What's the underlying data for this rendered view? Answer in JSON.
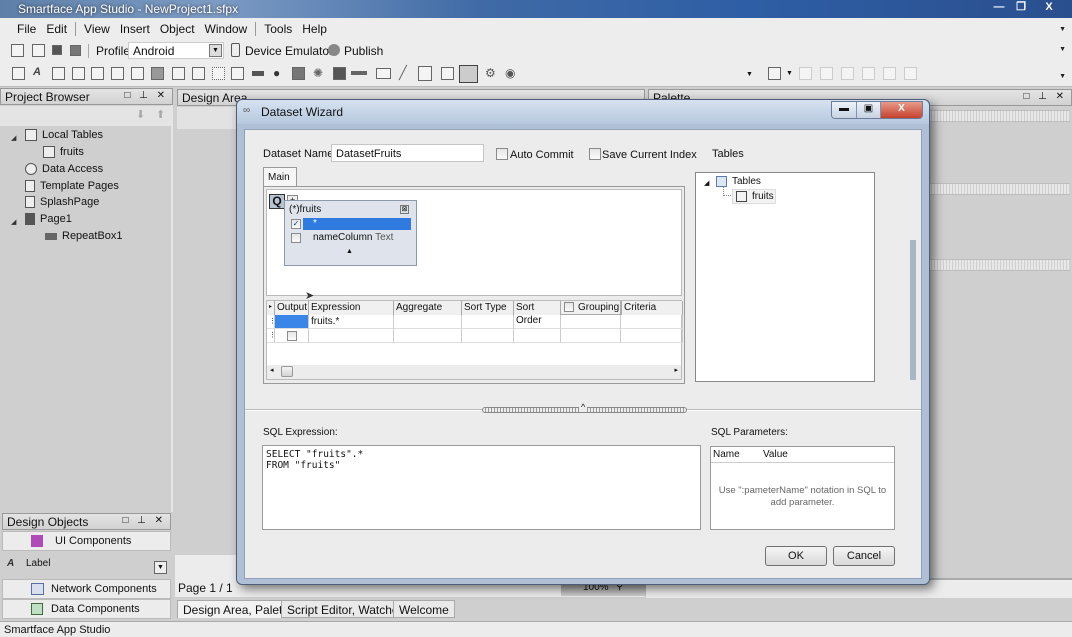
{
  "window": {
    "title": "Smartface App Studio - NewProject1.sfpx",
    "controls": {
      "minimize": "—",
      "restore": "❐",
      "close": "X"
    }
  },
  "menubar": {
    "items": [
      "File",
      "Edit",
      "View",
      "Insert",
      "Object",
      "Window",
      "Tools",
      "Help"
    ]
  },
  "toolbar": {
    "profile_label": "Profile",
    "profile_value": "Android",
    "device_emulator_label": "Device Emulator",
    "publish_label": "Publish"
  },
  "project_browser": {
    "title": "Project Browser",
    "items": [
      {
        "label": "Local Tables",
        "icon": "table-icon",
        "expanded": true
      },
      {
        "label": "fruits",
        "icon": "table-icon"
      },
      {
        "label": "Data Access",
        "icon": "data-access-icon"
      },
      {
        "label": "Template Pages",
        "icon": "template-page-icon"
      },
      {
        "label": "SplashPage",
        "icon": "page-icon"
      },
      {
        "label": "Page1",
        "icon": "page-icon",
        "expanded": true
      },
      {
        "label": "RepeatBox1",
        "icon": "repeatbox-icon"
      }
    ]
  },
  "design_area": {
    "title": "Design Area",
    "page_indicator": "Page  1 / 1",
    "zoom": "100%"
  },
  "palette": {
    "title": "Palette"
  },
  "design_objects": {
    "title": "Design Objects",
    "groups": [
      "UI Components",
      "Network Components",
      "Data Components"
    ],
    "current_item": "Label"
  },
  "bottom_tabs": [
    "Design Area, Palette",
    "Script Editor,  Watches",
    "Welcome"
  ],
  "status_bar": {
    "text": "Smartface App Studio"
  },
  "dialog": {
    "title": "Dataset Wizard",
    "dataset_name_label": "Dataset Name",
    "dataset_name_value": "DatasetFruits",
    "auto_commit_label": "Auto Commit",
    "auto_commit_checked": false,
    "save_current_index_label": "Save Current Index",
    "save_current_index_checked": false,
    "tables_label": "Tables",
    "main_tab": "Main",
    "query_btn": "Q",
    "add_btn": "+",
    "table_box": {
      "title": "(*)fruits",
      "rows": [
        {
          "label": "*",
          "type": "",
          "checked": true,
          "selected": true
        },
        {
          "label": "nameColumn",
          "type": "Text",
          "checked": false,
          "selected": false
        }
      ]
    },
    "grid": {
      "columns": [
        "Output",
        "Expression",
        "Aggregate",
        "Sort Type",
        "Sort Order",
        "Grouping",
        "Criteria"
      ],
      "rows": [
        {
          "output": true,
          "expression": "fruits.*",
          "aggregate": "",
          "sort_type": "",
          "sort_order": "",
          "grouping": "",
          "criteria": ""
        },
        {
          "output": false,
          "expression": "",
          "aggregate": "",
          "sort_type": "",
          "sort_order": "",
          "grouping": "",
          "criteria": ""
        }
      ]
    },
    "tables_tree": {
      "root": "Tables",
      "children": [
        "fruits"
      ]
    },
    "sql_expression_label": "SQL Expression:",
    "sql_expression": "SELECT \"fruits\".*\nFROM \"fruits\"",
    "sql_parameters_label": "SQL Parameters:",
    "sql_parameters_columns": [
      "Name",
      "Value"
    ],
    "sql_parameters_hint": "Use \":pameterName\" notation in SQL to add parameter.",
    "ok_label": "OK",
    "cancel_label": "Cancel"
  }
}
